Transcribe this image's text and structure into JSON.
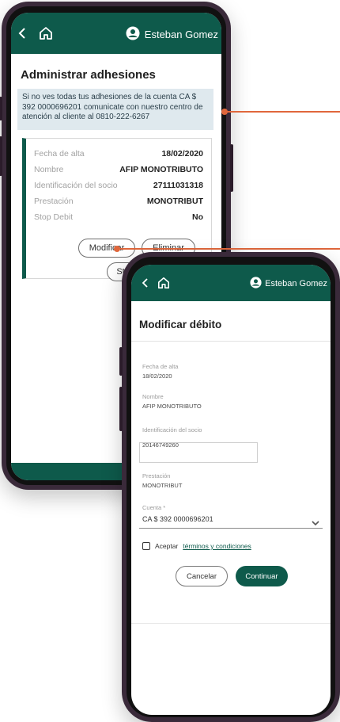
{
  "back_screen": {
    "user_name": "Esteban Gomez",
    "title": "Administrar adhesiones",
    "info_message": "Si no ves todas tus adhesiones de la cuenta CA $ 392 0000696201 comunicate con nuestro centro de atención al cliente al 0810-222-6267",
    "card": {
      "rows": [
        {
          "label": "Fecha de alta",
          "value": "18/02/2020"
        },
        {
          "label": "Nombre",
          "value": "AFIP MONOTRIBUTO"
        },
        {
          "label": "Identificación del socio",
          "value": "27111031318"
        },
        {
          "label": "Prestación",
          "value": "MONOTRIBUT"
        },
        {
          "label": "Stop Debit",
          "value": "No"
        }
      ],
      "buttons": {
        "modify": "Modificar",
        "delete": "Eliminar",
        "stop": "Stop Debit"
      }
    }
  },
  "front_screen": {
    "user_name": "Esteban Gomez",
    "title": "Modificar débito",
    "fields": [
      {
        "label": "Fecha de alta",
        "value": "18/02/2020"
      },
      {
        "label": "Nombre",
        "value": "AFIP MONOTRIBUTO"
      },
      {
        "label": "Identificación del socio",
        "value": "20146749260"
      },
      {
        "label": "Prestación",
        "value": "MONOTRIBUT"
      }
    ],
    "account_label": "Cuenta *",
    "account_value": "CA $ 392 0000696201",
    "accept_prefix": "Aceptar",
    "accept_link": "términos y condiciones",
    "cancel_label": "Cancelar",
    "continue_label": "Continuar"
  },
  "colors": {
    "brand": "#0e5a4b",
    "callout": "#e0673c",
    "frame": "#3a2a3a"
  },
  "icons": [
    "back-arrow-icon",
    "home-icon",
    "user-avatar-icon",
    "chevron-down-icon",
    "checkbox-icon"
  ]
}
